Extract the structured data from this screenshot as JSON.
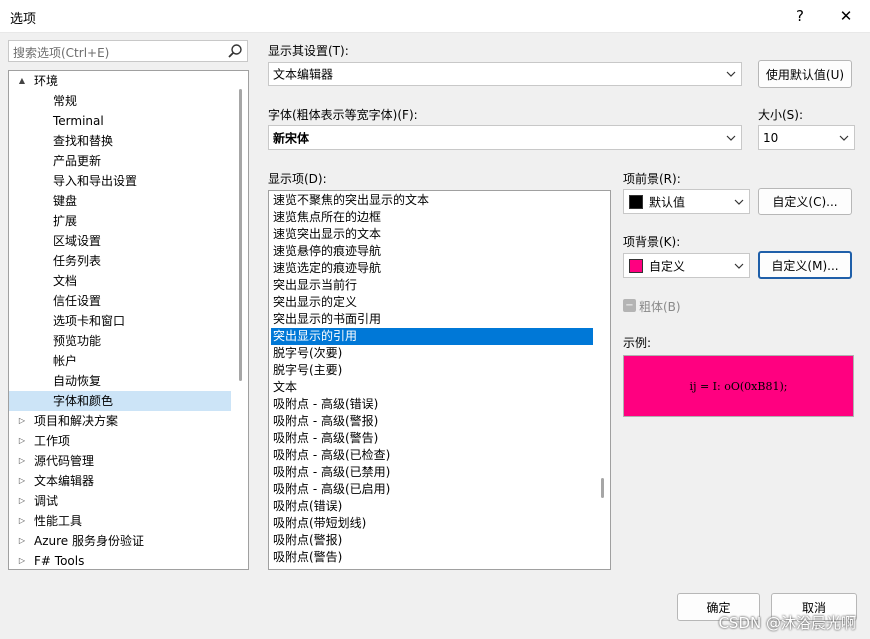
{
  "window": {
    "title": "选项",
    "help_glyph": "?",
    "close_glyph": "✕"
  },
  "search": {
    "placeholder": "搜索选项(Ctrl+E)"
  },
  "tree": [
    {
      "label": "环境",
      "arrow": "▲",
      "level": 0
    },
    {
      "label": "常规",
      "level": 1
    },
    {
      "label": "Terminal",
      "level": 1
    },
    {
      "label": "查找和替换",
      "level": 1
    },
    {
      "label": "产品更新",
      "level": 1
    },
    {
      "label": "导入和导出设置",
      "level": 1
    },
    {
      "label": "键盘",
      "level": 1
    },
    {
      "label": "扩展",
      "level": 1
    },
    {
      "label": "区域设置",
      "level": 1
    },
    {
      "label": "任务列表",
      "level": 1
    },
    {
      "label": "文档",
      "level": 1
    },
    {
      "label": "信任设置",
      "level": 1
    },
    {
      "label": "选项卡和窗口",
      "level": 1
    },
    {
      "label": "预览功能",
      "level": 1
    },
    {
      "label": "帐户",
      "level": 1
    },
    {
      "label": "自动恢复",
      "level": 1
    },
    {
      "label": "字体和颜色",
      "level": 1,
      "selected": true
    },
    {
      "label": "项目和解决方案",
      "arrow": "▷",
      "level": 0
    },
    {
      "label": "工作项",
      "arrow": "▷",
      "level": 0
    },
    {
      "label": "源代码管理",
      "arrow": "▷",
      "level": 0
    },
    {
      "label": "文本编辑器",
      "arrow": "▷",
      "level": 0
    },
    {
      "label": "调试",
      "arrow": "▷",
      "level": 0
    },
    {
      "label": "性能工具",
      "arrow": "▷",
      "level": 0
    },
    {
      "label": "Azure 服务身份验证",
      "arrow": "▷",
      "level": 0
    },
    {
      "label": "F# Tools",
      "arrow": "▷",
      "level": 0
    }
  ],
  "settings": {
    "show_settings_label": "显示其设置(T):",
    "show_settings_value": "文本编辑器",
    "use_defaults_button": "使用默认值(U)",
    "font_label": "字体(粗体表示等宽字体)(F):",
    "font_value": "新宋体",
    "size_label": "大小(S):",
    "size_value": "10",
    "display_items_label": "显示项(D):"
  },
  "display_items": [
    "速览不聚焦的突出显示的文本",
    "速览焦点所在的边框",
    "速览突出显示的文本",
    "速览悬停的痕迹导航",
    "速览选定的痕迹导航",
    "突出显示当前行",
    "突出显示的定义",
    "突出显示的书面引用",
    "突出显示的引用",
    "脱字号(次要)",
    "脱字号(主要)",
    "文本",
    "吸附点 - 高级(错误)",
    "吸附点 - 高级(警报)",
    "吸附点 - 高级(警告)",
    "吸附点 - 高级(已检查)",
    "吸附点 - 高级(已禁用)",
    "吸附点 - 高级(已启用)",
    "吸附点(错误)",
    "吸附点(带短划线)",
    "吸附点(警报)",
    "吸附点(警告)"
  ],
  "selected_item_index": 8,
  "foreground": {
    "label": "项前景(R):",
    "value": "默认值",
    "swatch_color": "#000000",
    "custom_button": "自定义(C)..."
  },
  "background": {
    "label": "项背景(K):",
    "value": "自定义",
    "swatch_color": "#ff0080",
    "custom_button": "自定义(M)..."
  },
  "bold": {
    "label": "粗体(B)",
    "checked": false
  },
  "sample": {
    "label": "示例:",
    "text": "ij = I: oO(0xB81);",
    "bg_color": "#ff0080",
    "fg_color": "#000000"
  },
  "footer": {
    "ok": "确定",
    "cancel": "取消"
  },
  "watermark": "CSDN @沐浴晨光啊",
  "colors": {
    "selection": "#0078d7",
    "tree_selection": "#cce4f7",
    "focus_border": "#1f5fa9"
  }
}
